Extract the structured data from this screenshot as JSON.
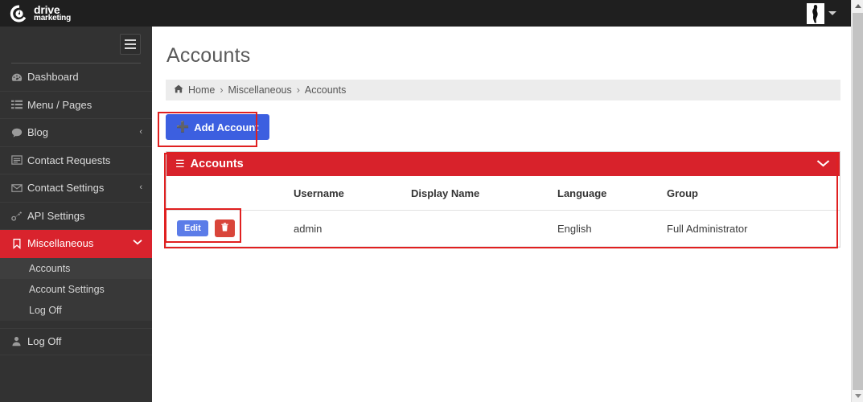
{
  "topbar": {
    "brand_line1": "drive",
    "brand_line2": "marketing",
    "brand_icon": "drive-circle-logo-icon",
    "avatar_icon": "user-photo-avatar",
    "user_caret_icon": "chevron-down-icon"
  },
  "sidebar": {
    "toggle_icon": "hamburger-menu-icon",
    "items": [
      {
        "label": "Dashboard",
        "icon": "dashboard-gauge-icon",
        "arrow": "",
        "active": false
      },
      {
        "label": "Menu / Pages",
        "icon": "list-icon",
        "arrow": "",
        "active": false
      },
      {
        "label": "Blog",
        "icon": "comment-icon",
        "arrow": "‹",
        "active": false
      },
      {
        "label": "Contact Requests",
        "icon": "form-window-icon",
        "arrow": "",
        "active": false
      },
      {
        "label": "Contact Settings",
        "icon": "envelope-icon",
        "arrow": "‹",
        "active": false
      },
      {
        "label": "API Settings",
        "icon": "key-link-icon",
        "arrow": "",
        "active": false
      },
      {
        "label": "Miscellaneous",
        "icon": "bookmark-icon",
        "arrow": "chevron-down-icon",
        "active": true
      }
    ],
    "submenu": [
      {
        "label": "Accounts",
        "selected": true
      },
      {
        "label": "Account Settings",
        "selected": false
      },
      {
        "label": "Log Off",
        "selected": false
      }
    ],
    "logoff": {
      "label": "Log Off",
      "icon": "user-icon"
    }
  },
  "main": {
    "page_title": "Accounts",
    "breadcrumb": {
      "home_icon": "home-icon",
      "items": [
        "Home",
        "Miscellaneous",
        "Accounts"
      ],
      "separator": "›"
    },
    "add_button": {
      "label": "Add Account",
      "icon": "plus-icon"
    },
    "panel": {
      "title": "Accounts",
      "bars_icon": "bars-icon",
      "collapse_icon": "chevron-down-icon"
    },
    "table": {
      "headers": [
        "",
        "Username",
        "Display Name",
        "Language",
        "Group"
      ],
      "rows": [
        {
          "edit_label": "Edit",
          "delete_icon": "trash-icon",
          "username": "admin",
          "display_name": "",
          "language": "English",
          "group": "Full Administrator"
        }
      ]
    }
  },
  "scrollbar": {
    "up_icon": "scroll-up-arrow-icon",
    "down_icon": "scroll-down-arrow-icon"
  },
  "colors": {
    "brand_red": "#d8222b",
    "sidebar_bg": "#323232",
    "topbar_bg": "#1f1f1f",
    "primary_blue": "#3c5fe0",
    "edit_blue": "#5b7ce8",
    "delete_red": "#d9453a",
    "annotation_red": "#e02020",
    "breadcrumb_bg": "#ececec"
  }
}
